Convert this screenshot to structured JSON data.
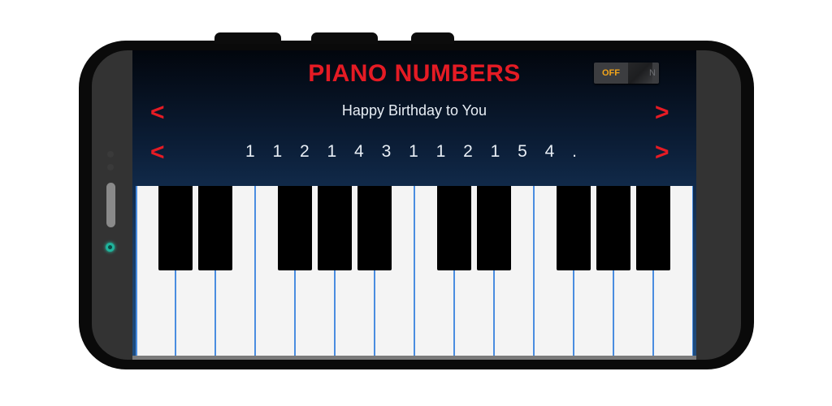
{
  "app": {
    "title": "PIANO NUMBERS",
    "toggle": {
      "off_label": "OFF",
      "on_label": "N",
      "state": "off"
    },
    "song": {
      "prev_icon": "<",
      "next_icon": ">",
      "name": "Happy Birthday to You"
    },
    "notes": {
      "prev_icon": "<",
      "next_icon": ">",
      "sequence": "1 1 2 1 4 3 1 1 2 1 5 4 ."
    },
    "keyboard": {
      "white_keys": 14,
      "black_key_groups": [
        2,
        3,
        2,
        3
      ]
    }
  },
  "colors": {
    "accent_red": "#e51b24",
    "toggle_off_text": "#f2a51a",
    "camera": "#1fb39b",
    "key_divider": "#4a8de0"
  }
}
